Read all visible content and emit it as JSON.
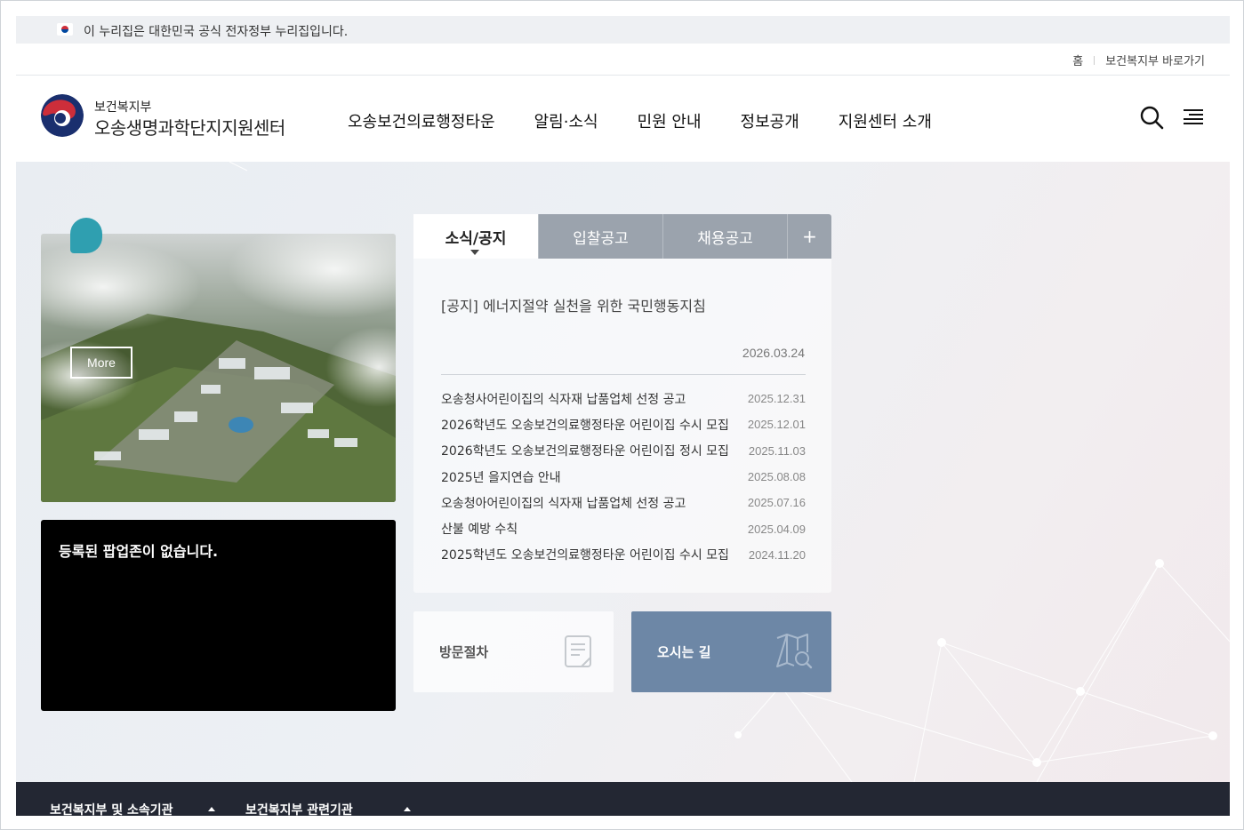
{
  "gov_banner": {
    "text": "이 누리집은 대한민국 공식 전자정부 누리집입니다."
  },
  "util": {
    "home": "홈",
    "ministry_link": "보건복지부 바로가기"
  },
  "logo": {
    "ministry": "보건복지부",
    "center": "오송생명과학단지지원센터"
  },
  "gnb": [
    {
      "label": "오송보건의료행정타운"
    },
    {
      "label": "알림·소식"
    },
    {
      "label": "민원 안내"
    },
    {
      "label": "정보공개"
    },
    {
      "label": "지원센터 소개"
    }
  ],
  "header_icons": [
    "search-icon",
    "menu-icon"
  ],
  "visual": {
    "more_label": "More",
    "popup_msg": "등록된 팝업존이 없습니다."
  },
  "board": {
    "tabs": [
      "소식/공지",
      "입찰공고",
      "채용공고"
    ],
    "plus": "+",
    "featured": {
      "title": "[공지] 에너지절약 실천을 위한 국민행동지침",
      "date": "2026.03.24"
    },
    "items": [
      {
        "title": "오송청사어린이집의 식자재 납품업체 선정 공고",
        "date": "2025.12.31"
      },
      {
        "title": "2026학년도 오송보건의료행정타운 어린이집 수시 모집",
        "date": "2025.12.01"
      },
      {
        "title": "2026학년도 오송보건의료행정타운 어린이집 정시 모집",
        "date": "2025.11.03"
      },
      {
        "title": "2025년 을지연습 안내",
        "date": "2025.08.08"
      },
      {
        "title": "오송청아어린이집의 식자재 납품업체 선정 공고",
        "date": "2025.07.16"
      },
      {
        "title": "산불 예방 수칙",
        "date": "2025.04.09"
      },
      {
        "title": "2025학년도 오송보건의료행정타운 어린이집 수시 모집",
        "date": "2024.11.20"
      }
    ]
  },
  "quick": {
    "visit": "방문절차",
    "route": "오시는 길"
  },
  "footer": {
    "sel1": "보건복지부 및 소속기관",
    "sel2": "보건복지부 관련기관"
  },
  "colors": {
    "tab_gray": "#9ba3ad",
    "route_bg": "#6d87a6",
    "badge": "#2f9fb0",
    "footer_bg": "#232733"
  }
}
